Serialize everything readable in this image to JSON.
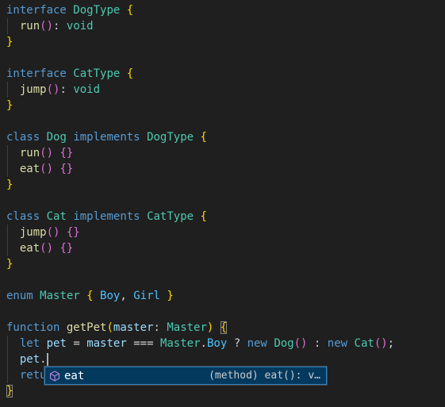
{
  "editor": {
    "language": "typescript",
    "cursor_line": 23,
    "cursor_text": "pet."
  },
  "suggest": {
    "selected_label": "eat",
    "selected_detail": "(method) eat(): v…",
    "icon": "method-cube-icon"
  },
  "colors": {
    "background": "#1f1f1f",
    "keyword": "#569cd6",
    "type": "#4ec9b0",
    "function": "#dcdcaa",
    "variable": "#9cdcfe",
    "bracket_level1": "#ffd700",
    "bracket_level2": "#da70d6",
    "suggest_selection": "#04395e"
  },
  "code": {
    "l1": {
      "t1": "interface",
      "t2": "DogType",
      "t3": "{"
    },
    "l2": {
      "t1": "run",
      "t2": "()",
      "t3": ":",
      "t4": "void"
    },
    "l3": {
      "t1": "}"
    },
    "l5": {
      "t1": "interface",
      "t2": "CatType",
      "t3": "{"
    },
    "l6": {
      "t1": "jump",
      "t2": "()",
      "t3": ":",
      "t4": "void"
    },
    "l7": {
      "t1": "}"
    },
    "l9": {
      "t1": "class",
      "t2": "Dog",
      "t3": "implements",
      "t4": "DogType",
      "t5": "{"
    },
    "l10": {
      "t1": "run",
      "t2": "()",
      "t3": "{}"
    },
    "l11": {
      "t1": "eat",
      "t2": "()",
      "t3": "{}"
    },
    "l12": {
      "t1": "}"
    },
    "l14": {
      "t1": "class",
      "t2": "Cat",
      "t3": "implements",
      "t4": "CatType",
      "t5": "{"
    },
    "l15": {
      "t1": "jump",
      "t2": "()",
      "t3": "{}"
    },
    "l16": {
      "t1": "eat",
      "t2": "()",
      "t3": "{}"
    },
    "l17": {
      "t1": "}"
    },
    "l19": {
      "t1": "enum",
      "t2": "Master",
      "t3": "{",
      "t4": "Boy",
      "t5": ",",
      "t6": "Girl",
      "t7": "}"
    },
    "l21": {
      "t1": "function",
      "t2": "getPet",
      "t3": "(",
      "t4": "master",
      "t5": ":",
      "t6": "Master",
      "t7": ")",
      "t8": "{"
    },
    "l22": {
      "t1": "let",
      "t2": "pet",
      "t3": "=",
      "t4": "master",
      "t5": "===",
      "t6": "Master",
      "t7": ".",
      "t8": "Boy",
      "t9": "?",
      "t10": "new",
      "t11": "Dog",
      "t12": "()",
      "t13": ":",
      "t14": "new",
      "t15": "Cat",
      "t16": "()",
      "t17": ";"
    },
    "l23": {
      "t1": "pet",
      "t2": "."
    },
    "l24": {
      "t1": "retu"
    },
    "l25": {
      "t1": "}"
    }
  }
}
